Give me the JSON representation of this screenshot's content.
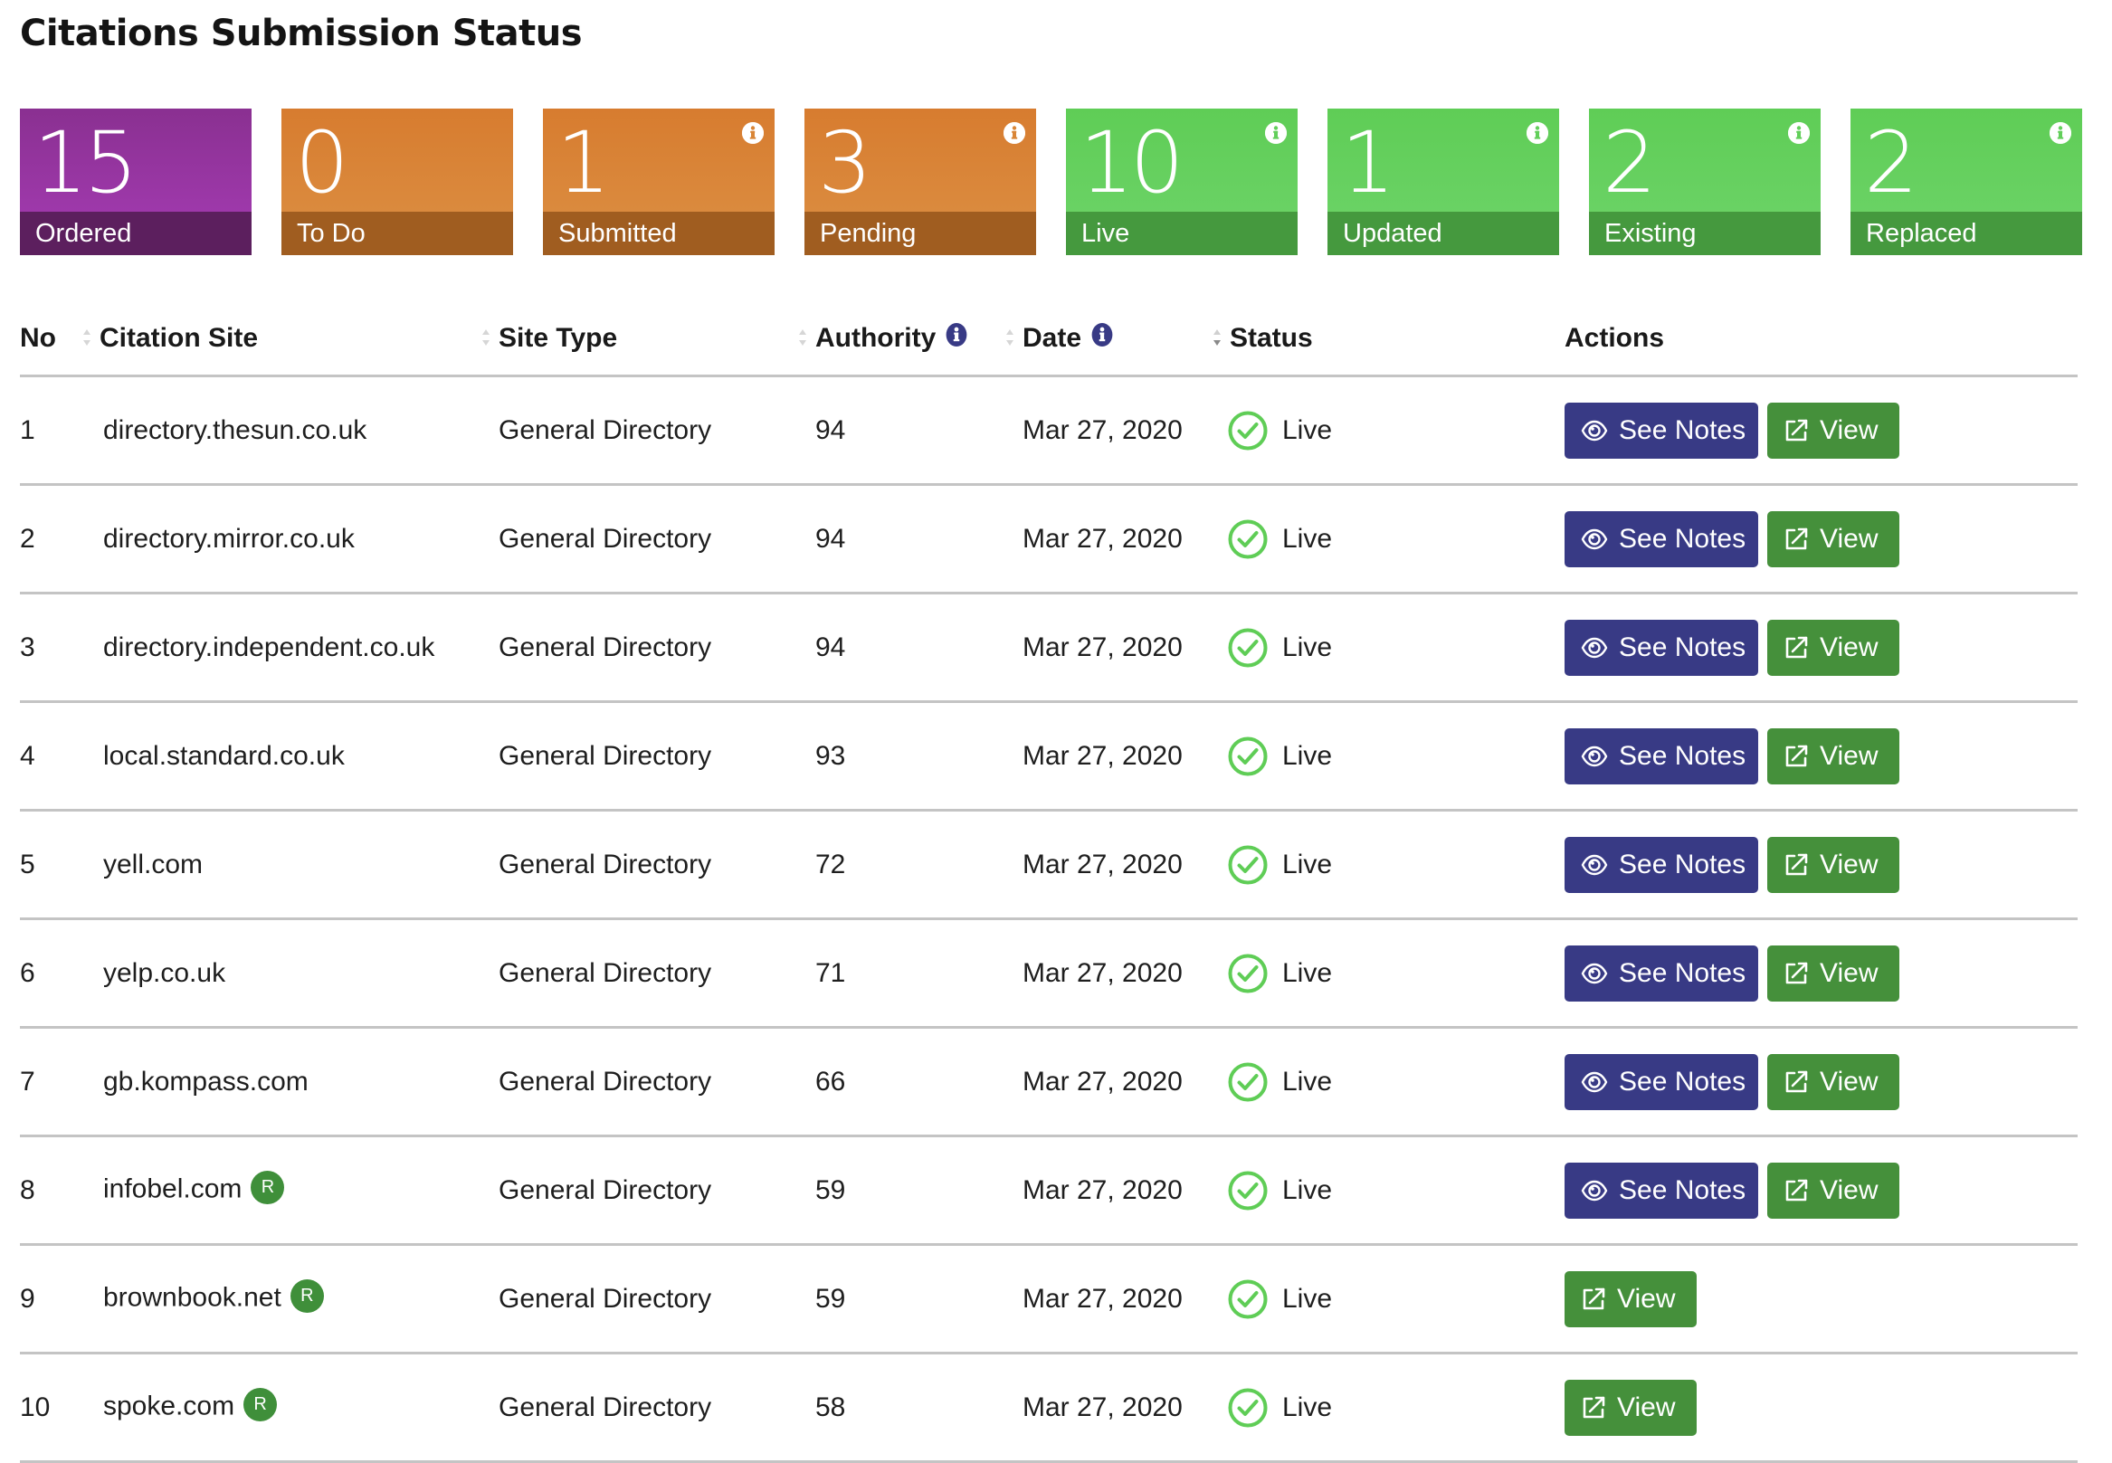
{
  "page": {
    "title": "Citations Submission Status"
  },
  "cards": [
    {
      "value": "15",
      "label": "Ordered",
      "theme": "purple",
      "info": false
    },
    {
      "value": "0",
      "label": "To Do",
      "theme": "orange",
      "info": false
    },
    {
      "value": "1",
      "label": "Submitted",
      "theme": "orange",
      "info": true
    },
    {
      "value": "3",
      "label": "Pending",
      "theme": "orange",
      "info": true
    },
    {
      "value": "10",
      "label": "Live",
      "theme": "green",
      "info": true
    },
    {
      "value": "1",
      "label": "Updated",
      "theme": "green",
      "info": true
    },
    {
      "value": "2",
      "label": "Existing",
      "theme": "green",
      "info": true
    },
    {
      "value": "2",
      "label": "Replaced",
      "theme": "green",
      "info": true
    }
  ],
  "colors": {
    "purple": "#a63cb5",
    "orange": "#d77c2f",
    "green": "#5fcd56",
    "notes_button": "#383a85",
    "view_button": "#45903b",
    "live_check": "#5fcd56",
    "badge": "#3f8f3a",
    "info_icon": "#383a85"
  },
  "table": {
    "columns": {
      "no": "No",
      "site": "Citation Site",
      "type": "Site Type",
      "authority": "Authority",
      "date": "Date",
      "status": "Status",
      "actions": "Actions"
    },
    "sorted_column": "status",
    "sort_direction": "desc",
    "see_notes_label": "See Notes",
    "view_label": "View",
    "badge_label": "R",
    "rows": [
      {
        "no": "1",
        "site": "directory.thesun.co.uk",
        "badge": false,
        "type": "General Directory",
        "authority": "94",
        "date": "Mar 27, 2020",
        "status": "Live",
        "notes": true
      },
      {
        "no": "2",
        "site": "directory.mirror.co.uk",
        "badge": false,
        "type": "General Directory",
        "authority": "94",
        "date": "Mar 27, 2020",
        "status": "Live",
        "notes": true
      },
      {
        "no": "3",
        "site": "directory.independent.co.uk",
        "badge": false,
        "type": "General Directory",
        "authority": "94",
        "date": "Mar 27, 2020",
        "status": "Live",
        "notes": true
      },
      {
        "no": "4",
        "site": "local.standard.co.uk",
        "badge": false,
        "type": "General Directory",
        "authority": "93",
        "date": "Mar 27, 2020",
        "status": "Live",
        "notes": true
      },
      {
        "no": "5",
        "site": "yell.com",
        "badge": false,
        "type": "General Directory",
        "authority": "72",
        "date": "Mar 27, 2020",
        "status": "Live",
        "notes": true
      },
      {
        "no": "6",
        "site": "yelp.co.uk",
        "badge": false,
        "type": "General Directory",
        "authority": "71",
        "date": "Mar 27, 2020",
        "status": "Live",
        "notes": true
      },
      {
        "no": "7",
        "site": "gb.kompass.com",
        "badge": false,
        "type": "General Directory",
        "authority": "66",
        "date": "Mar 27, 2020",
        "status": "Live",
        "notes": true
      },
      {
        "no": "8",
        "site": "infobel.com",
        "badge": true,
        "type": "General Directory",
        "authority": "59",
        "date": "Mar 27, 2020",
        "status": "Live",
        "notes": true
      },
      {
        "no": "9",
        "site": "brownbook.net",
        "badge": true,
        "type": "General Directory",
        "authority": "59",
        "date": "Mar 27, 2020",
        "status": "Live",
        "notes": false
      },
      {
        "no": "10",
        "site": "spoke.com",
        "badge": true,
        "type": "General Directory",
        "authority": "58",
        "date": "Mar 27, 2020",
        "status": "Live",
        "notes": false
      }
    ]
  }
}
